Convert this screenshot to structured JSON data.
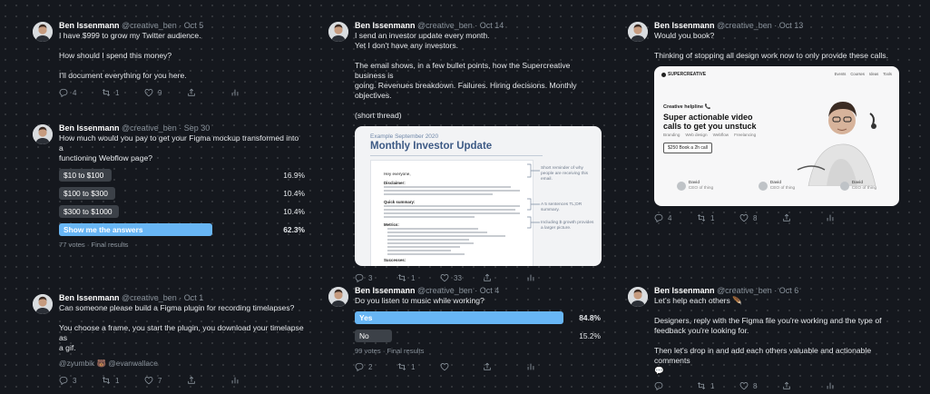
{
  "author": {
    "name": "Ben Issenmann",
    "handle": "@creative_ben"
  },
  "tweets": {
    "t1": {
      "date": "Oct 5",
      "lines": [
        "I have $999 to grow my Twitter audience.",
        "",
        "How should I spend this money?",
        "",
        "I'll document everything for you here."
      ],
      "replies": "4",
      "retweets": "1",
      "likes": "9"
    },
    "t2": {
      "date": "Sep 30",
      "lines": [
        "How much would you pay to get your Figma mockup transformed into a",
        "functioning Webflow page?"
      ],
      "poll": [
        {
          "label": "$10 to $100",
          "percent": "16.9%",
          "value": 16.9
        },
        {
          "label": "$100 to $300",
          "percent": "10.4%",
          "value": 10.4
        },
        {
          "label": "$300 to $1000",
          "percent": "10.4%",
          "value": 10.4
        },
        {
          "label": "Show me the answers",
          "percent": "62.3%",
          "value": 62.3
        }
      ],
      "votes": "77 votes · Final results"
    },
    "t3": {
      "date": "Oct 1",
      "lines": [
        "Can someone please build a Figma plugin for recording timelapses?",
        "",
        "You choose a frame, you start the plugin, you download your timelapse as",
        "a gif."
      ],
      "mentions": "@zyumbik 🐻 @evanwallace",
      "replies": "3",
      "retweets": "1",
      "likes": "7"
    },
    "t4": {
      "date": "Oct 14",
      "lines": [
        "I send an investor update every month.",
        "Yet I don't have any investors.",
        "",
        "The email shows, in a few bullet points, how the Supercreative business is",
        "going. Revenues breakdown. Failures. Hiring decisions. Monthly",
        "objectives.",
        "",
        "(short thread)"
      ],
      "card": {
        "kicker": "Example September 2020",
        "title": "Monthly Investor Update",
        "greeting": "Hey everyone,",
        "notes": [
          "Short reminder of why people are receiving this email.",
          "A 5 sentences TL;DR summary.",
          "Including $ growth provides a larger picture."
        ],
        "sections": [
          "Disclaimer:",
          "Quick summary:",
          "Metrics:",
          "Successes:"
        ]
      },
      "replies": "3",
      "retweets": "1",
      "likes": "33"
    },
    "t5": {
      "date": "Oct 4",
      "lines": [
        "Do you listen to music while working?"
      ],
      "poll": [
        {
          "label": "Yes",
          "percent": "84.8%",
          "value": 84.8
        },
        {
          "label": "No",
          "percent": "15.2%",
          "value": 15.2
        }
      ],
      "votes": "99 votes · Final results",
      "replies": "2",
      "retweets": "1"
    },
    "t6": {
      "date": "Oct 13",
      "lines": [
        "Would you book?",
        "",
        "Thinking of stopping all design work now to only provide these calls."
      ],
      "card": {
        "brand": "SUPERCREATIVE",
        "nav": [
          "Events",
          "Courses",
          "Ideas",
          "Tools"
        ],
        "kicker": "Creative helpline 📞",
        "headline1": "Super actionable video",
        "headline2": "calls to get you unstuck",
        "tags": [
          "Branding",
          "Web design",
          "Webflow",
          "Freelancing"
        ],
        "cta": "$250 Book a 2h call",
        "people": [
          {
            "name": "David",
            "role": "CEO of thing"
          },
          {
            "name": "David",
            "role": "CEO of thing"
          },
          {
            "name": "David",
            "role": "CEO of thing"
          }
        ]
      },
      "replies": "4",
      "retweets": "1",
      "likes": "8"
    },
    "t7": {
      "date": "Oct 6",
      "lines": [
        "Let's help each others 🪶",
        "",
        "Designers, reply with the Figma file you're working and the type of",
        "feedback you're looking for.",
        "",
        "Then let's drop in and add each others valuable and actionable comments",
        "💬"
      ],
      "retweets": "1",
      "likes": "8"
    }
  }
}
